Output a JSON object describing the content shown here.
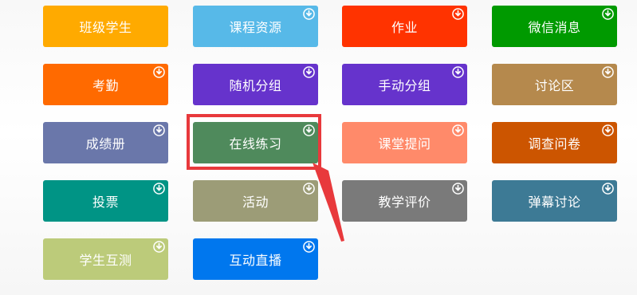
{
  "colors": {
    "class_students": "#ffaa00",
    "course_resources": "#57b9e8",
    "homework": "#ff3300",
    "wechat_messages": "#009a00",
    "attendance": "#ff6a00",
    "random_grouping": "#6633cc",
    "manual_grouping": "#6633cc",
    "discussion_area": "#b5894d",
    "gradebook": "#6a77aa",
    "online_practice": "#4f8a5c",
    "class_questions": "#ff8a6a",
    "questionnaire": "#cc5500",
    "voting": "#009485",
    "activities": "#9c9c77",
    "teaching_evaluation": "#7a7a7a",
    "danmaku_discussion": "#3d7a95",
    "student_mutual_test": "#bccb7a",
    "live_streaming": "#0077ee",
    "highlight": "#e8393c"
  },
  "download_icon": "download-circle-icon",
  "tiles": [
    {
      "label": "班级学生",
      "download": false
    },
    {
      "label": "课程资源",
      "download": true
    },
    {
      "label": "作业",
      "download": true
    },
    {
      "label": "微信消息",
      "download": true
    },
    {
      "label": "考勤",
      "download": true
    },
    {
      "label": "随机分组",
      "download": true
    },
    {
      "label": "手动分组",
      "download": true
    },
    {
      "label": "讨论区",
      "download": true
    },
    {
      "label": "成绩册",
      "download": true
    },
    {
      "label": "在线练习",
      "download": true
    },
    {
      "label": "课堂提问",
      "download": true
    },
    {
      "label": "调查问卷",
      "download": true
    },
    {
      "label": "投票",
      "download": true
    },
    {
      "label": "活动",
      "download": true
    },
    {
      "label": "教学评价",
      "download": true
    },
    {
      "label": "弹幕讨论",
      "download": true
    },
    {
      "label": "学生互测",
      "download": true
    },
    {
      "label": "互动直播",
      "download": true
    }
  ]
}
